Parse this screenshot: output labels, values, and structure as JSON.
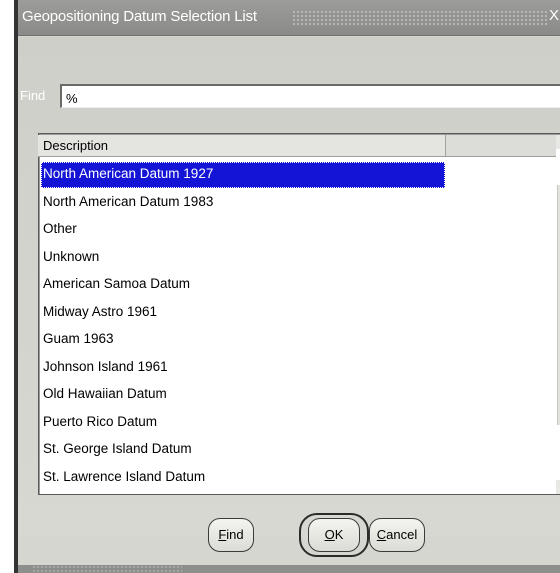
{
  "window": {
    "title": "Geopositioning Datum Selection List",
    "close_glyph": "X"
  },
  "find": {
    "label": "Find",
    "value": "%"
  },
  "list": {
    "column_header": "Description",
    "selected_index": 0,
    "items": [
      "North American Datum 1927",
      "North American Datum 1983",
      "Other",
      "Unknown",
      "American Samoa Datum",
      "Midway Astro 1961",
      "Guam 1963",
      "Johnson Island 1961",
      "Old Hawaiian Datum",
      "Puerto Rico Datum",
      "St. George Island Datum",
      "St. Lawrence Island Datum"
    ]
  },
  "buttons": {
    "find": {
      "accel": "F",
      "rest": "ind"
    },
    "ok": {
      "accel": "O",
      "rest": "K"
    },
    "cancel": {
      "accel": "C",
      "rest": "ancel"
    }
  },
  "colors": {
    "selection": "#1414d6",
    "titlebar": "#8e8e8c",
    "dialog_bg": "#d6d6d0"
  }
}
